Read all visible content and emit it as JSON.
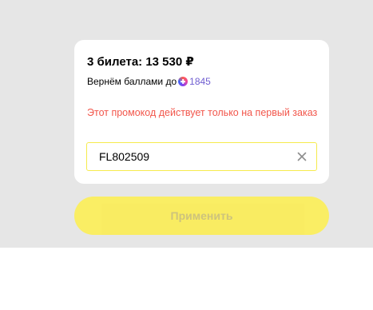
{
  "card": {
    "title": "3 билета: 13 530 ₽",
    "cashback_prefix": "Вернём баллами до",
    "cashback_points": "1845",
    "plus_icon": "plus-points-icon",
    "error_text": "Этот промокод действует только на первый заказ",
    "promo_input": {
      "value": "FL802509",
      "placeholder": ""
    },
    "clear_icon": "close-icon"
  },
  "apply_button": {
    "label": "Применить"
  },
  "colors": {
    "error": "#f2564b",
    "accent_yellow": "#fdee4c",
    "points": "#6f5dd0"
  }
}
